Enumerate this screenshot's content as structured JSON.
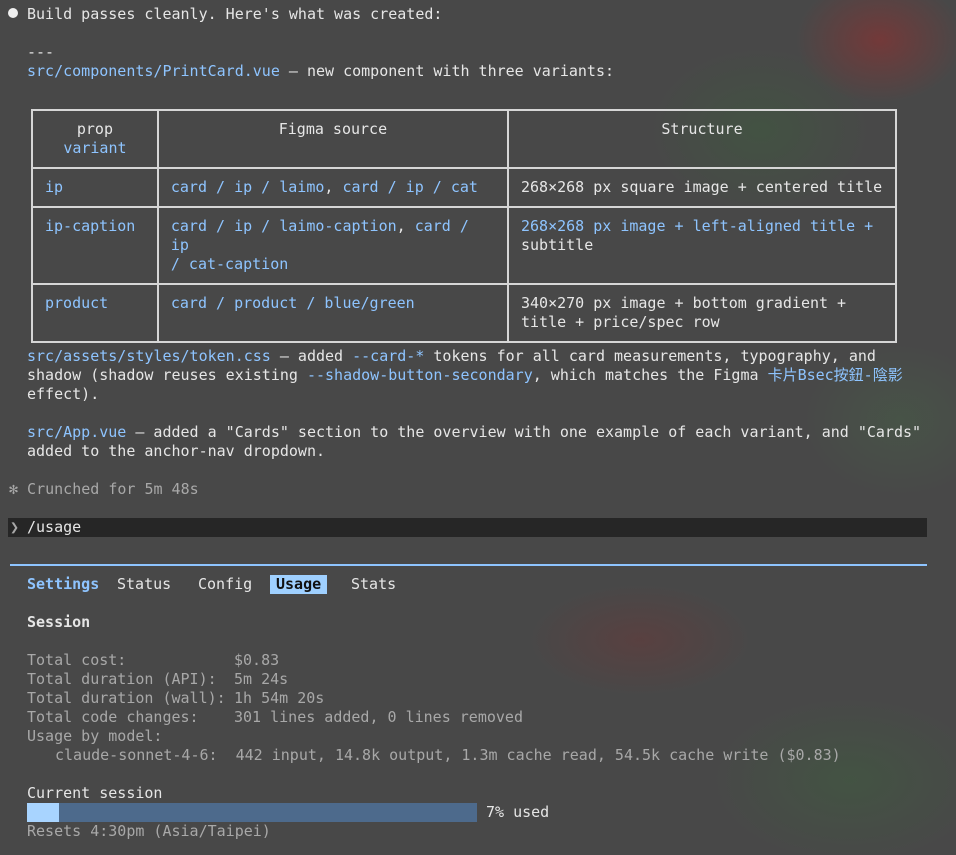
{
  "message": {
    "intro": "Build passes cleanly. Here's what was created:",
    "separator": "---",
    "printcard_file": "src/components/PrintCard.vue",
    "printcard_desc": " — new component with three variants:",
    "table": {
      "headers": {
        "prop_a": "prop",
        "prop_b": "variant",
        "figma": "Figma source",
        "structure": "Structure"
      },
      "rows": [
        {
          "prop": "ip",
          "figma1": "card / ip / laimo",
          "figma_sep": ", ",
          "figma2": "card / ip / cat",
          "figma3": "",
          "structure1": "268×268 px square image + centered title",
          "structure2": ""
        },
        {
          "prop": "ip-caption",
          "figma1": "card / ip / laimo-caption",
          "figma_sep": ", ",
          "figma2": "card / ip",
          "figma3": " / cat-caption",
          "structure1": "268×268 px image + left-aligned title +",
          "structure2": "subtitle"
        },
        {
          "prop": "product",
          "figma1": "card / product / blue/green",
          "figma_sep": "",
          "figma2": "",
          "figma3": "",
          "structure1": "340×270 px image + bottom gradient +",
          "structure2": "title + price/spec row"
        }
      ]
    },
    "token_file": "src/assets/styles/token.css",
    "token_desc1": " — added ",
    "token_var": "--card-*",
    "token_desc2": " tokens for all card measurements, typography, and",
    "token_desc3": "shadow (shadow reuses existing ",
    "token_var2": "--shadow-button-secondary",
    "token_desc4": ", which matches the Figma ",
    "token_figma": "卡片Bsec按鈕-陰影",
    "token_desc5": "effect).",
    "app_file": "src/App.vue",
    "app_desc1": " — added a \"Cards\" section to the overview with one example of each variant, and \"Cards\"",
    "app_desc2": "added to the anchor-nav dropdown.",
    "crunched": "✻ Crunched for 5m 48s"
  },
  "input": {
    "prompt_glyph": "❯",
    "command": "/usage"
  },
  "tabs": {
    "settings": "Settings",
    "status": "Status",
    "config": "Config",
    "usage": "Usage",
    "stats": "Stats"
  },
  "session": {
    "heading": "Session",
    "rows": [
      {
        "label": "Total cost:",
        "value": "$0.83"
      },
      {
        "label": "Total duration (API):",
        "value": "5m 24s"
      },
      {
        "label": "Total duration (wall):",
        "value": "1h 54m 20s"
      },
      {
        "label": "Total code changes:",
        "value": "301 lines added, 0 lines removed"
      }
    ],
    "usage_by_model": "Usage by model:",
    "model_line": "claude-sonnet-4-6:  442 input, 14.8k output, 1.3m cache read, 54.5k cache write ($0.83)"
  },
  "current": {
    "heading": "Current session",
    "used_pct": 7,
    "used_label": "7% used",
    "resets": "Resets 4:30pm (Asia/Taipei)"
  },
  "colors": {
    "accent": "#8ec4ff",
    "active_tab": "#9fd0ff",
    "progress_track": "#4d6a8c"
  }
}
